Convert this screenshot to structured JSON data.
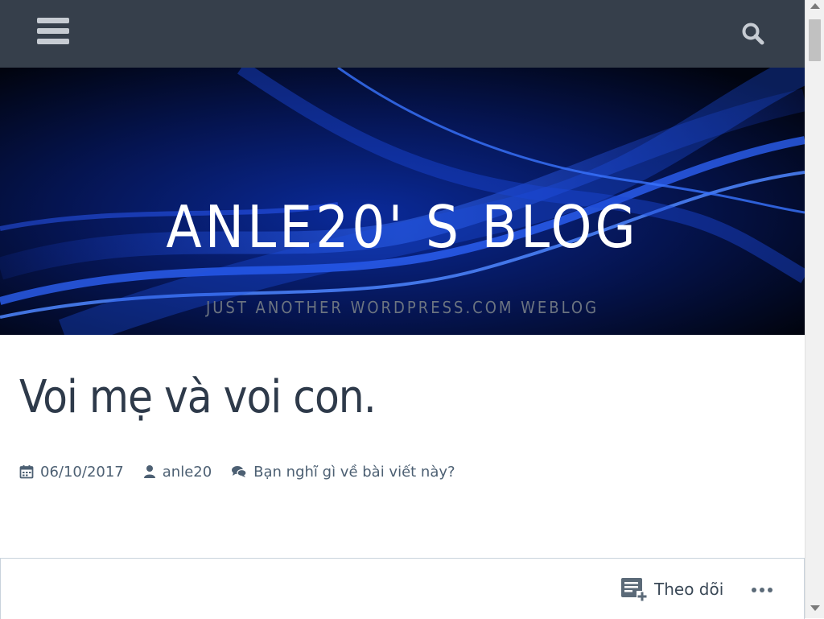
{
  "topbar": {
    "menu_icon": "hamburger-menu-icon",
    "search_icon": "search-icon",
    "background": "#363f4b"
  },
  "header": {
    "site_title": "ANLE20' S BLOG",
    "tagline": "JUST ANOTHER WORDPRESS.COM WEBLOG"
  },
  "post": {
    "title": "Voi mẹ và voi con.",
    "date": "06/10/2017",
    "author": "anle20",
    "comments_link": "Bạn nghĩ gì về bài viết này?"
  },
  "follow_bar": {
    "follow_label": "Theo dõi",
    "more_icon": "ellipsis-icon"
  },
  "colors": {
    "title": "#2e3a4a",
    "meta": "#4d6073",
    "header_bg": "#020716"
  }
}
